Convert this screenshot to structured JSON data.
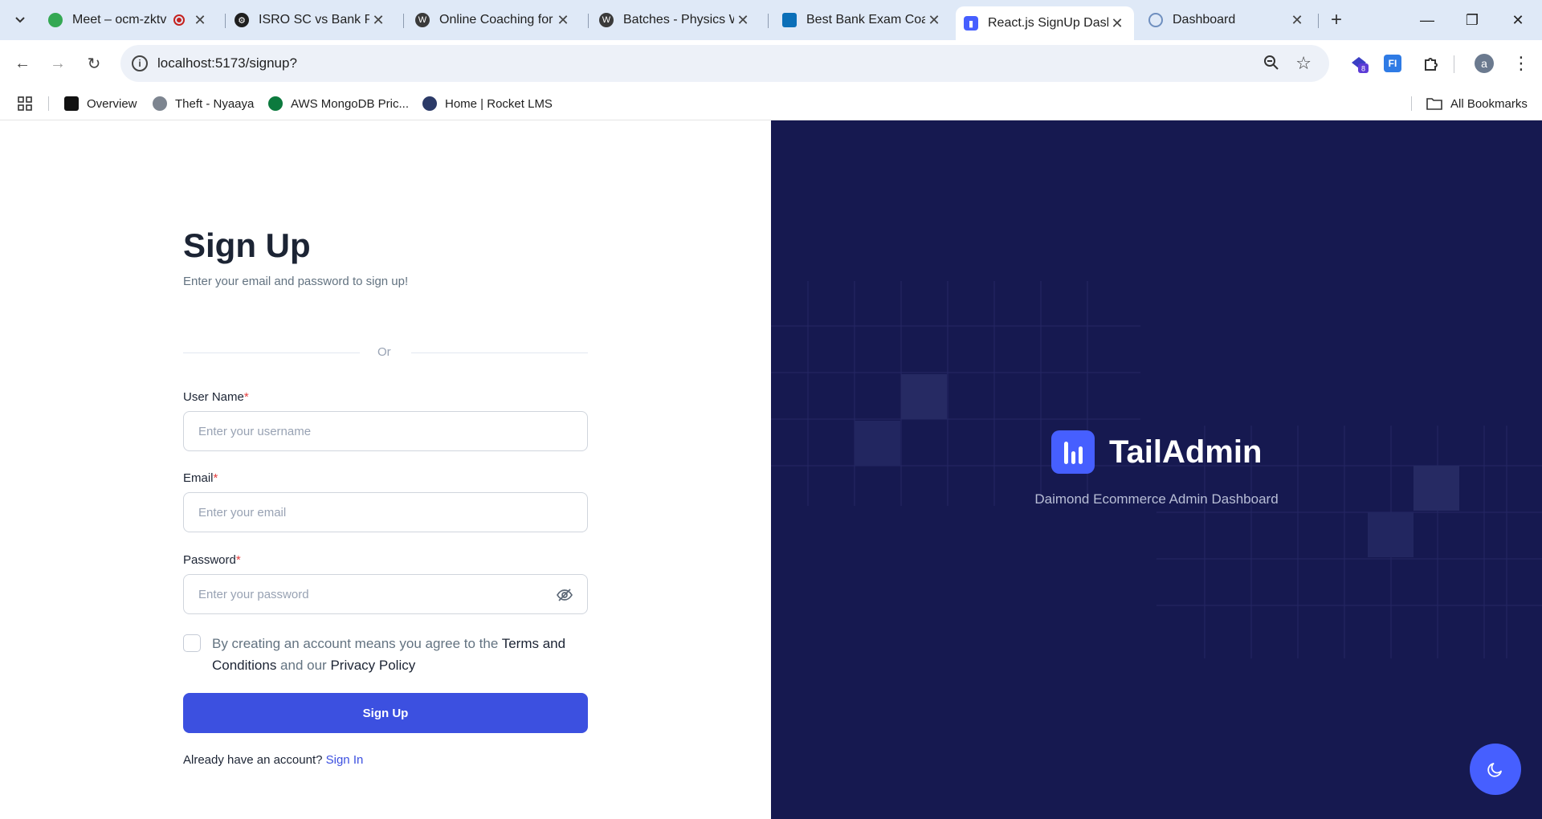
{
  "browser": {
    "tabs": [
      {
        "title": "Meet – ocm-zktv",
        "active": false
      },
      {
        "title": "ISRO SC vs Bank PO",
        "active": false
      },
      {
        "title": "Online Coaching for I",
        "active": false
      },
      {
        "title": "Batches - Physics Wa",
        "active": false
      },
      {
        "title": "Best Bank Exam Coac",
        "active": false
      },
      {
        "title": "React.js SignUp Dash",
        "active": true
      },
      {
        "title": "Dashboard",
        "active": false
      }
    ],
    "url": "localhost:5173/signup?",
    "extension_badge": "8",
    "profile_initial": "a",
    "bookmarks": [
      "Overview",
      "Theft - Nyaaya",
      "AWS MongoDB Pric...",
      "Home | Rocket LMS"
    ],
    "all_bookmarks": "All Bookmarks"
  },
  "signup": {
    "title": "Sign Up",
    "subtitle": "Enter your email and password to sign up!",
    "divider": "Or",
    "username_label": "User Name",
    "username_placeholder": "Enter your username",
    "email_label": "Email",
    "email_placeholder": "Enter your email",
    "password_label": "Password",
    "password_placeholder": "Enter your password",
    "required_mark": "*",
    "terms_prefix": "By creating an account means you agree to the ",
    "terms_link": "Terms and Conditions",
    "terms_middle": " and our ",
    "privacy_link": "Privacy Policy",
    "submit": "Sign Up",
    "already": "Already have an account? ",
    "signin_link": "Sign In"
  },
  "brand": {
    "name": "TailAdmin",
    "tagline": "Daimond Ecommerce Admin Dashboard"
  },
  "colors": {
    "primary": "#3c50e0",
    "brand_panel": "#161950",
    "logo": "#465fff"
  }
}
